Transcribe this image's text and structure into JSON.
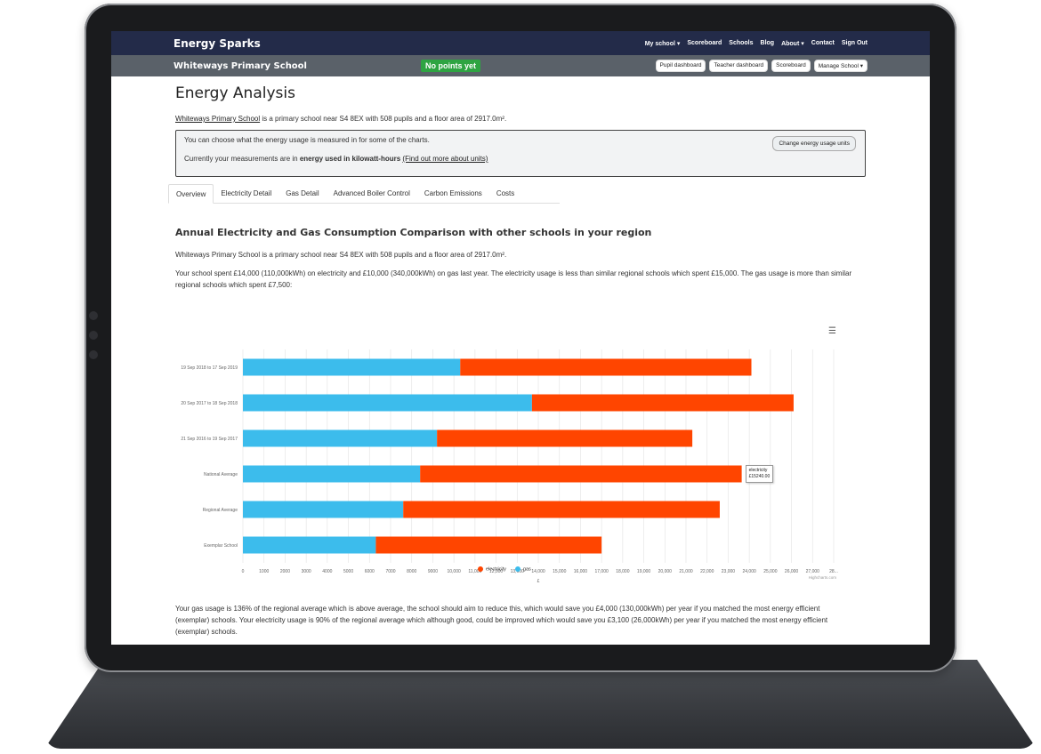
{
  "navbar": {
    "brand": "Energy Sparks",
    "links": [
      "My school ▾",
      "Scoreboard",
      "Schools",
      "Blog",
      "About ▾",
      "Contact",
      "Sign Out"
    ]
  },
  "subbar": {
    "school_name": "Whiteways Primary School",
    "points_badge": "No points yet",
    "buttons": [
      "Pupil dashboard",
      "Teacher dashboard",
      "Scoreboard",
      "Manage School ▾"
    ]
  },
  "page": {
    "title": "Energy Analysis",
    "intro_link": "Whiteways Primary School",
    "intro_rest": " is a primary school near S4 8EX with 508 pupils and a floor area of 2917.0m².",
    "units_line1": "You can choose what the energy usage is measured in for some of the charts.",
    "units_line2_pre": "Currently your measurements are in ",
    "units_line2_bold": "energy used in kilowatt-hours",
    "units_link": "(Find out more about units)",
    "units_button": "Change energy usage units"
  },
  "tabs": [
    "Overview",
    "Electricity Detail",
    "Gas Detail",
    "Advanced Boiler Control",
    "Carbon Emissions",
    "Costs"
  ],
  "section": {
    "title": "Annual Electricity and Gas Consumption Comparison with other schools in your region",
    "para1": "Whiteways Primary School is a primary school near S4 8EX with 508 pupils and a floor area of 2917.0m².",
    "para2": "Your school spent £14,000 (110,000kWh) on electricity and £10,000 (340,000kWh) on gas last year. The electricity usage is less than similar regional schools which spent £15,000. The gas usage is more than similar regional schools which spent £7,500:"
  },
  "chart_data": {
    "type": "bar",
    "orientation": "horizontal",
    "stacked": true,
    "categories": [
      "19 Sep 2018 to 17 Sep 2019",
      "20 Sep 2017 to 18 Sep 2018",
      "21 Sep 2016 to 19 Sep 2017",
      "National Average",
      "Regional Average",
      "Exemplar School"
    ],
    "series": [
      {
        "name": "gas",
        "color": "#3cbcec",
        "values": [
          10300,
          13700,
          9200,
          8400,
          7600,
          6300
        ]
      },
      {
        "name": "electricity",
        "color": "#ff4500",
        "values": [
          13800,
          12400,
          12100,
          15240,
          15000,
          10700
        ]
      }
    ],
    "xlabel": "£",
    "xlim": [
      0,
      28000
    ],
    "x_ticks": [
      "0",
      "1000",
      "2000",
      "3000",
      "4000",
      "5000",
      "6000",
      "7000",
      "8000",
      "9000",
      "10,000",
      "11,000",
      "12,000",
      "13,000",
      "14,000",
      "15,000",
      "16,000",
      "17,000",
      "18,000",
      "19,000",
      "20,000",
      "21,000",
      "22,000",
      "23,000",
      "24,000",
      "25,000",
      "26,000",
      "27,000",
      "28..."
    ],
    "legend": [
      "electricity",
      "gas"
    ],
    "tooltip": {
      "series": "electricity",
      "value": "£15240.00"
    },
    "credit": "Highcharts.com"
  },
  "summary": "Your gas usage is 136% of the regional average which is above average, the school should aim to reduce this, which would save you £4,000 (130,000kWh) per year if you matched the most energy efficient (exemplar) schools. Your electricity usage is 90% of the regional average which although good, could be improved which would save you £3,100 (26,000kWh) per year if you matched the most energy efficient (exemplar) schools."
}
